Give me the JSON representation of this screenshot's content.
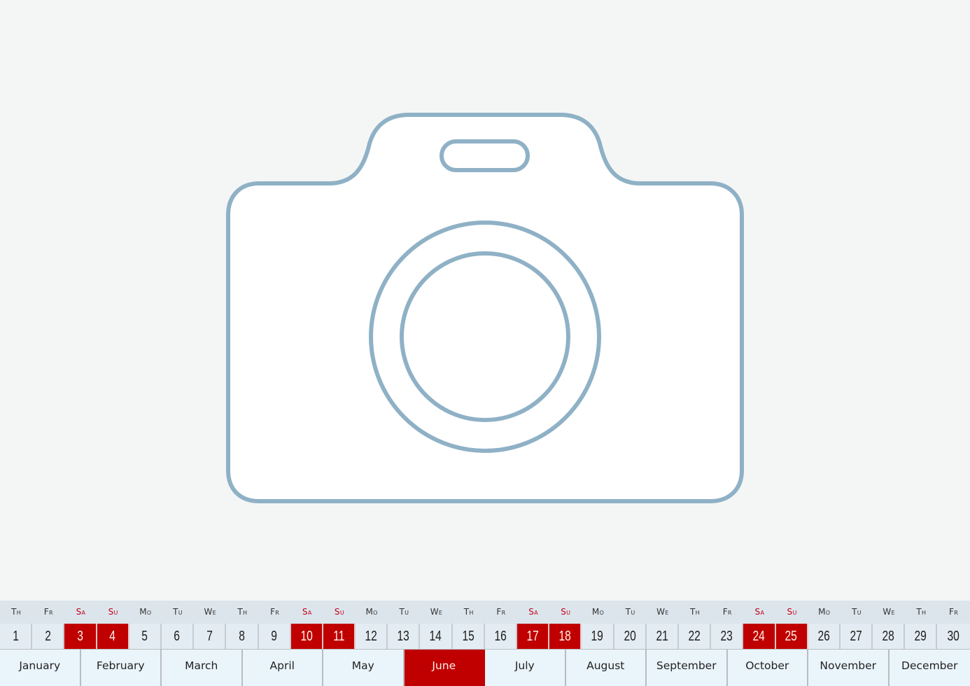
{
  "illustration": {
    "icon": "camera-outline-icon",
    "stroke_color": "#8fb1c6",
    "fill_color": "#ffffff"
  },
  "calendar": {
    "accent_color": "#c00000",
    "selected_month": "June",
    "weekdays": [
      "Th",
      "Fr",
      "Sa",
      "Su",
      "Mo",
      "Tu",
      "We",
      "Th",
      "Fr",
      "Sa",
      "Su",
      "Mo",
      "Tu",
      "We",
      "Th",
      "Fr",
      "Sa",
      "Su",
      "Mo",
      "Tu",
      "We",
      "Th",
      "Fr",
      "Sa",
      "Su",
      "Mo",
      "Tu",
      "We",
      "Th",
      "Fr"
    ],
    "days": [
      "1",
      "2",
      "3",
      "4",
      "5",
      "6",
      "7",
      "8",
      "9",
      "10",
      "11",
      "12",
      "13",
      "14",
      "15",
      "16",
      "17",
      "18",
      "19",
      "20",
      "21",
      "22",
      "23",
      "24",
      "25",
      "26",
      "27",
      "28",
      "29",
      "30"
    ],
    "weekend_days": [
      3,
      4,
      10,
      11,
      17,
      18,
      24,
      25
    ],
    "months": [
      "January",
      "February",
      "March",
      "April",
      "May",
      "June",
      "July",
      "August",
      "September",
      "October",
      "November",
      "December"
    ]
  }
}
